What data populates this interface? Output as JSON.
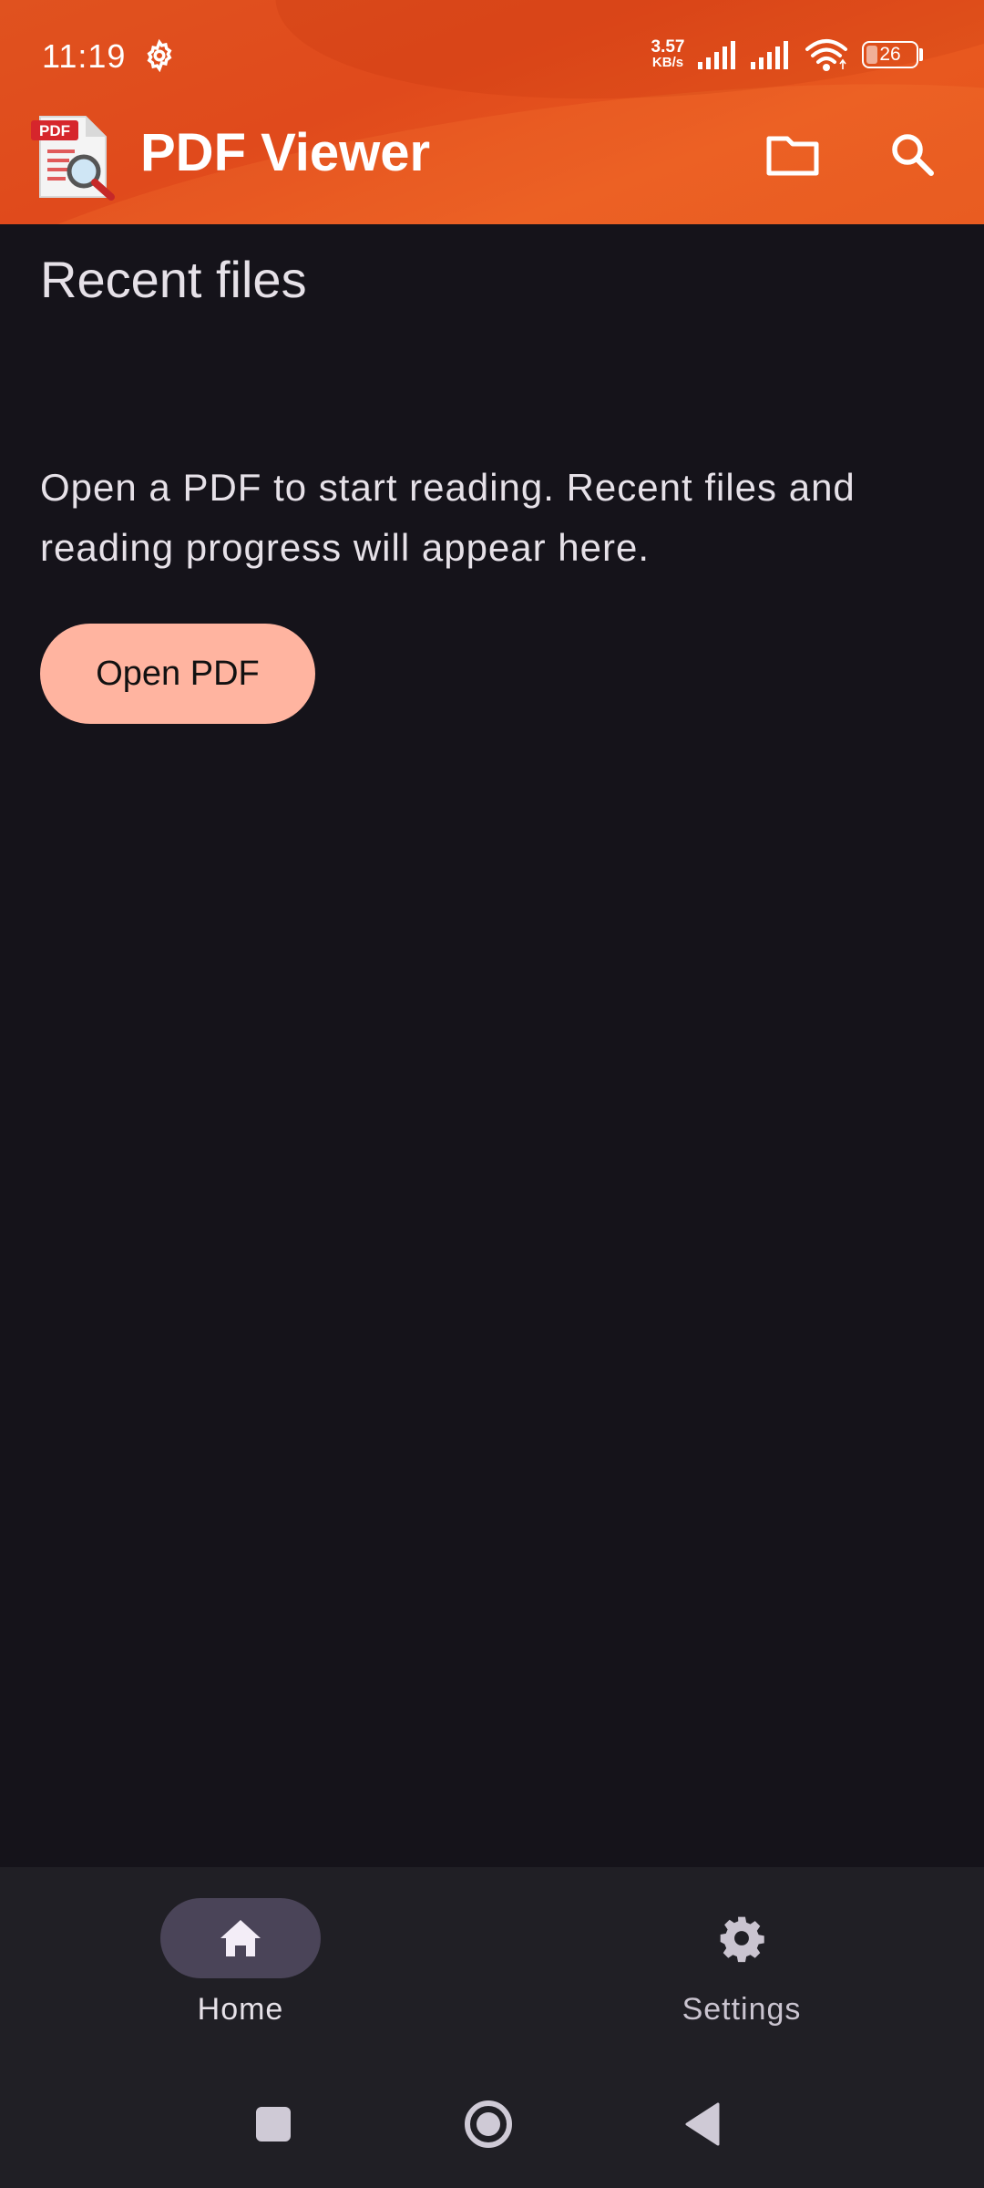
{
  "status_bar": {
    "time": "11:19",
    "net_speed_value": "3.57",
    "net_speed_unit": "KB/s",
    "battery_level": "26",
    "icons": [
      "settings-gear-icon",
      "signal-icon",
      "signal-icon",
      "wifi-icon",
      "battery-icon"
    ]
  },
  "app_bar": {
    "logo_icon": "pdf-search-logo-icon",
    "logo_text": "PDF",
    "title": "PDF Viewer",
    "actions": [
      "folder-icon",
      "search-icon"
    ]
  },
  "main": {
    "section_title": "Recent files",
    "empty_message": "Open a PDF to start reading. Recent files and reading progress will appear here.",
    "open_button_label": "Open PDF"
  },
  "bottom_nav": {
    "items": [
      {
        "label": "Home",
        "icon": "home-icon",
        "selected": true
      },
      {
        "label": "Settings",
        "icon": "settings-icon",
        "selected": false
      }
    ]
  },
  "system_nav": {
    "buttons": [
      "recents-icon",
      "home-circle-icon",
      "back-icon"
    ]
  },
  "colors": {
    "app_bar": "#e4521c",
    "background": "#15131a",
    "button": "#ffb4a0",
    "nav_bar": "#201f25",
    "nav_pill": "#4a4458"
  }
}
